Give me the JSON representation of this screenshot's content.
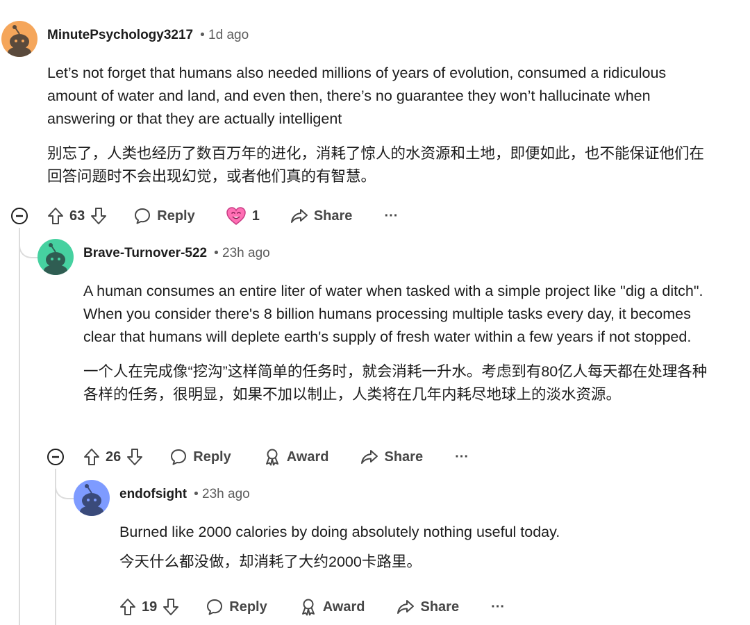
{
  "comments": [
    {
      "username": "MinutePsychology3217",
      "time": "• 1d ago",
      "body_en": "Let’s not forget that humans also needed millions of years of evolution, consumed a ridiculous amount of water and land, and even then, there’s no guarantee they won’t hallucinate when answering or that they are actually intelligent",
      "body_zh": "别忘了，人类也经历了数百万年的进化，消耗了惊人的水资源和土地，即便如此，也不能保证他们在回答问题时不会出现幻觉，或者他们真的有智慧。",
      "votes": "63",
      "reply_label": "Reply",
      "award_count": "1",
      "share_label": "Share",
      "more": "···",
      "avatar_color": "#f5a65b"
    },
    {
      "username": "Brave-Turnover-522",
      "time": "• 23h ago",
      "body_en": "A human consumes an entire liter of water when tasked with a simple project like \"dig a ditch\". When you consider there's 8 billion humans processing multiple tasks every day, it becomes clear that humans will deplete earth's supply of fresh water within a few years if not stopped.",
      "body_zh": "一个人在完成像“挖沟”这样简单的任务时，就会消耗一升水。考虑到有80亿人每天都在处理各种各样的任务，很明显，如果不加以制止，人类将在几年内耗尽地球上的淡水资源。",
      "votes": "26",
      "reply_label": "Reply",
      "award_label": "Award",
      "share_label": "Share",
      "more": "···",
      "avatar_color": "#46d1a0"
    },
    {
      "username": "endofsight",
      "time": "• 23h ago",
      "body_en": "Burned like 2000 calories by doing absolutely nothing useful today.",
      "body_zh": "今天什么都没做，却消耗了大约2000卡路里。",
      "votes": "19",
      "reply_label": "Reply",
      "award_label": "Award",
      "share_label": "Share",
      "more": "···",
      "avatar_color": "#7e9bff"
    }
  ],
  "icons": {
    "collapse": "collapse-icon",
    "upvote": "upvote-icon",
    "downvote": "downvote-icon",
    "reply": "reply-icon",
    "award": "award-icon",
    "share": "share-icon",
    "heart_award": "heart-eyes-award-icon"
  }
}
